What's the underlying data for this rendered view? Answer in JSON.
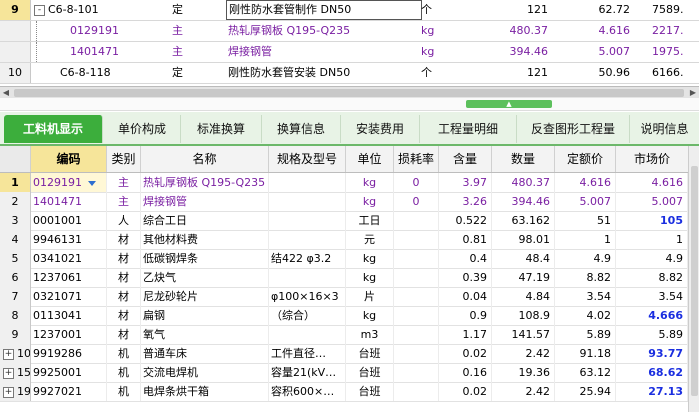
{
  "top_rows": [
    {
      "num": "9",
      "expander": "-",
      "code": "C6-8-101",
      "type": "定",
      "name": "刚性防水套管制作 DN50",
      "unit": "个",
      "qty": "121",
      "price": "62.72",
      "amount": "7589."
    },
    {
      "num": "",
      "code": "0129191",
      "type": "主",
      "name": "热轧厚钢板 Q195-Q235",
      "unit": "kg",
      "qty": "480.37",
      "price": "4.616",
      "amount": "2217."
    },
    {
      "num": "",
      "code": "1401471",
      "type": "主",
      "name": "焊接钢管",
      "unit": "kg",
      "qty": "394.46",
      "price": "5.007",
      "amount": "1975."
    },
    {
      "num": "10",
      "code": "C6-8-118",
      "type": "定",
      "name": "刚性防水套管安装 DN50",
      "unit": "个",
      "qty": "121",
      "price": "50.96",
      "amount": "6166."
    }
  ],
  "tabs": [
    "工料机显示",
    "单价构成",
    "标准换算",
    "换算信息",
    "安装费用",
    "工程量明细",
    "反查图形工程量",
    "说明信息"
  ],
  "headers": {
    "code": "编码",
    "cat": "类别",
    "name": "名称",
    "spec": "规格及型号",
    "unit": "单位",
    "loss": "损耗率",
    "content": "含量",
    "qty": "数量",
    "quota": "定额价",
    "market": "市场价"
  },
  "rows": [
    {
      "rn": "1",
      "exp": "",
      "code": "0129191",
      "cat": "主",
      "name": "热轧厚钢板 Q195-Q235",
      "spec": "",
      "unit": "kg",
      "loss": "0",
      "content": "3.97",
      "qty": "480.37",
      "quota": "4.616",
      "market": "4.616"
    },
    {
      "rn": "2",
      "exp": "",
      "code": "1401471",
      "cat": "主",
      "name": "焊接钢管",
      "spec": "",
      "unit": "kg",
      "loss": "0",
      "content": "3.26",
      "qty": "394.46",
      "quota": "5.007",
      "market": "5.007"
    },
    {
      "rn": "3",
      "exp": "",
      "code": "0001001",
      "cat": "人",
      "name": "综合工日",
      "spec": "",
      "unit": "工日",
      "loss": "",
      "content": "0.522",
      "qty": "63.162",
      "quota": "51",
      "market": "105"
    },
    {
      "rn": "4",
      "exp": "",
      "code": "9946131",
      "cat": "材",
      "name": "其他材料费",
      "spec": "",
      "unit": "元",
      "loss": "",
      "content": "0.81",
      "qty": "98.01",
      "quota": "1",
      "market": "1"
    },
    {
      "rn": "5",
      "exp": "",
      "code": "0341021",
      "cat": "材",
      "name": "低碳钢焊条",
      "spec": "结422 φ3.2",
      "unit": "kg",
      "loss": "",
      "content": "0.4",
      "qty": "48.4",
      "quota": "4.9",
      "market": "4.9"
    },
    {
      "rn": "6",
      "exp": "",
      "code": "1237061",
      "cat": "材",
      "name": "乙炔气",
      "spec": "",
      "unit": "kg",
      "loss": "",
      "content": "0.39",
      "qty": "47.19",
      "quota": "8.82",
      "market": "8.82"
    },
    {
      "rn": "7",
      "exp": "",
      "code": "0321071",
      "cat": "材",
      "name": "尼龙砂轮片",
      "spec": "φ100×16×3",
      "unit": "片",
      "loss": "",
      "content": "0.04",
      "qty": "4.84",
      "quota": "3.54",
      "market": "3.54"
    },
    {
      "rn": "8",
      "exp": "",
      "code": "0113041",
      "cat": "材",
      "name": "扁钢",
      "spec": "（综合）",
      "unit": "kg",
      "loss": "",
      "content": "0.9",
      "qty": "108.9",
      "quota": "4.02",
      "market": "4.666"
    },
    {
      "rn": "9",
      "exp": "",
      "code": "1237001",
      "cat": "材",
      "name": "氧气",
      "spec": "",
      "unit": "m3",
      "loss": "",
      "content": "1.17",
      "qty": "141.57",
      "quota": "5.89",
      "market": "5.89"
    },
    {
      "rn": "10",
      "exp": "+",
      "code": "9919286",
      "cat": "机",
      "name": "普通车床",
      "spec": "工件直径…",
      "unit": "台班",
      "loss": "",
      "content": "0.02",
      "qty": "2.42",
      "quota": "91.18",
      "market": "93.77"
    },
    {
      "rn": "15",
      "exp": "+",
      "code": "9925001",
      "cat": "机",
      "name": "交流电焊机",
      "spec": "容量21(kV…",
      "unit": "台班",
      "loss": "",
      "content": "0.16",
      "qty": "19.36",
      "quota": "63.12",
      "market": "68.62"
    },
    {
      "rn": "19",
      "exp": "+",
      "code": "9927021",
      "cat": "机",
      "name": "电焊条烘干箱",
      "spec": "容积600×…",
      "unit": "台班",
      "loss": "",
      "content": "0.02",
      "qty": "2.42",
      "quota": "25.94",
      "market": "27.13"
    }
  ],
  "colors": {
    "purple": "#7a1fa2",
    "blue": "#1a2ee0",
    "green": "#3cae3c",
    "highlight": "#f6e59a"
  }
}
